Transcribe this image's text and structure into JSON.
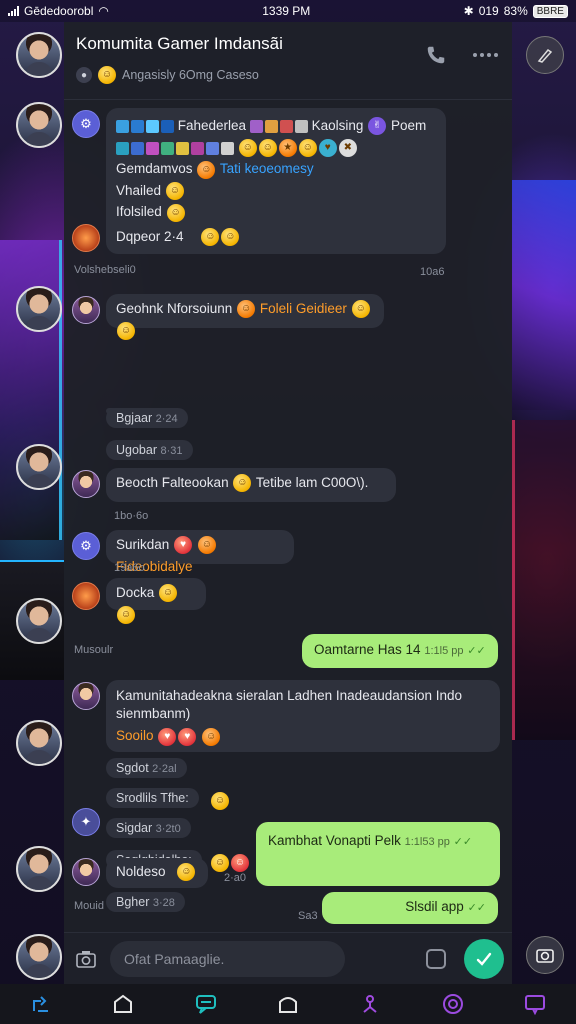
{
  "status_bar": {
    "carrier": "Gēdedoorobl",
    "time": "1339 PM",
    "right_text": "019",
    "battery_percent": "83%",
    "battery_badge": "BBRE"
  },
  "chat": {
    "title": "Komumita Gamer Imdansãi",
    "subtitle": "Angasisly 6Omg Caseso"
  },
  "messages": {
    "m1_line1": "Fahederlea",
    "m1_line1b": "Kaolsing",
    "m1_line1c": "Poem",
    "m1_line3a": "Gemdamvos",
    "m1_line3b": "Tati keoeomesy",
    "m1_line4": "Vhailed",
    "m1_line5": "Ifolsiled",
    "m1_line6": "Dqpeor 2·4",
    "label1": "Volshebseli0",
    "label1_time": "10a6",
    "m2_text": "Geohnk Nforsoiunn",
    "m2_orange": "Foleli Geidieer",
    "pill1": "Bgjaar",
    "pill1_meta": "2·24",
    "pill2": "Ugobar",
    "pill2_meta": "8·31",
    "m3_text": "Beocth Falteookan",
    "m3_text2": "Tetibe lam",
    "m3_text3": "C00O\\).",
    "label2": "1bo·6o",
    "m4_text": "Surikdan",
    "m4_orange": "Fideobidalye",
    "label3": "19a6o",
    "m5_text": "Docka",
    "label4": "Musoulr",
    "out1_text": "Oamtarne Has 14",
    "out1_meta": "1:1l5 pp",
    "m6_text": "Kamunitahadeakna sieralan Ladhen Inadeaudansion Indo sienmbanm)",
    "m6_orange": "Sooilo",
    "pill3": "Sgdot",
    "pill3_meta": "2·2al",
    "pill4": "Srodlils Tfhe:",
    "pill5": "Sigdar",
    "pill5_meta": "3·2t0",
    "pill6": "Saglghidalhe:",
    "label5": "Mouid",
    "out2_text": "Kambhat Vonapti Pelk",
    "out2_meta": "1:1l53 pp",
    "m7_text": "Noldeso",
    "m7_meta": "2·a0",
    "pill7": "Bgher",
    "pill7_meta": "3·28",
    "out3_text": "Slsdil app",
    "out3_side": "Sa3"
  },
  "composer": {
    "placeholder": "Ofat Pamaaglie."
  },
  "icons": {
    "phone": "phone-icon",
    "more": "more-icon",
    "camera": "camera-icon",
    "send": "send-icon",
    "sticker": "sticker-icon"
  },
  "colors": {
    "accent_green": "#a8ec7a",
    "send_button": "#1fbf8f",
    "bubble_dark": "#2e313c",
    "highlight_orange": "#ff9d2a",
    "highlight_blue": "#38a3ff"
  }
}
